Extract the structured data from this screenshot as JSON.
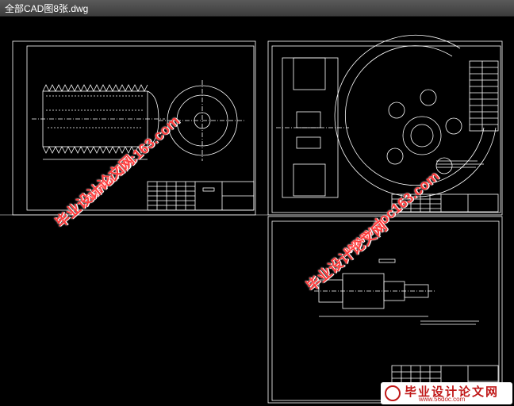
{
  "window": {
    "title": "全部CAD图8张.dwg"
  },
  "watermark": {
    "cn": "毕业设计论文网",
    "url": "www.doc163.com"
  },
  "logo": {
    "cn": "毕业设计论文网",
    "url": "www.56doc.com"
  },
  "colors": {
    "drawing": "#ffffff",
    "background": "#000000",
    "watermark": "#ff3d3d"
  }
}
